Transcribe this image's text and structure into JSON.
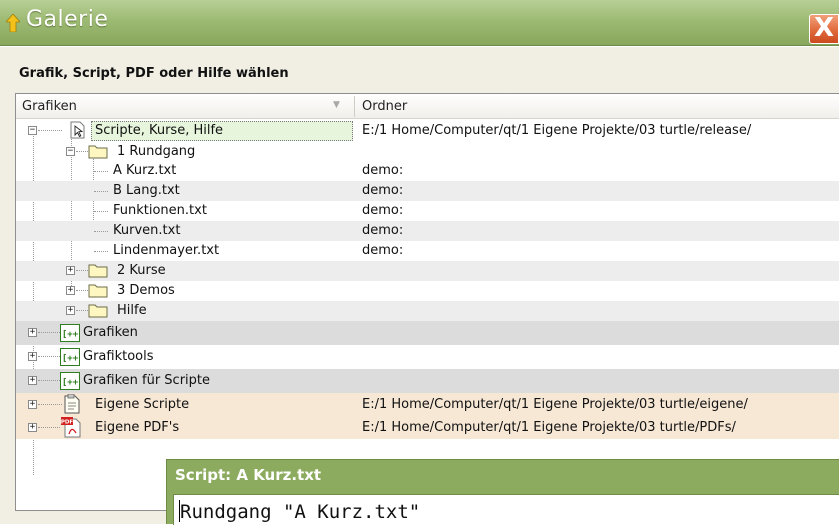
{
  "window": {
    "title": "Galerie",
    "close_label": "X"
  },
  "dialog": {
    "prompt": "Grafik, Script, PDF oder Hilfe wählen"
  },
  "tree": {
    "columns": [
      "Grafiken",
      "Ordner"
    ],
    "rows": [
      {
        "label": "Scripte, Kurse, Hilfe",
        "folder": "E:/1 Home/Computer/qt/1 Eigene Projekte/03 turtle/release/",
        "icon": "script-arrow-icon",
        "expander": "minus",
        "selected": true
      },
      {
        "label": "1 Rundgang",
        "folder": "",
        "icon": "folder-icon",
        "expander": "minus"
      },
      {
        "label": "A Kurz.txt",
        "folder": "demo:",
        "icon": ""
      },
      {
        "label": "B Lang.txt",
        "folder": "demo:",
        "icon": ""
      },
      {
        "label": "Funktionen.txt",
        "folder": "demo:",
        "icon": ""
      },
      {
        "label": "Kurven.txt",
        "folder": "demo:",
        "icon": ""
      },
      {
        "label": "Lindenmayer.txt",
        "folder": "demo:",
        "icon": ""
      },
      {
        "label": "2 Kurse",
        "folder": "",
        "icon": "folder-icon",
        "expander": "plus"
      },
      {
        "label": "3 Demos",
        "folder": "",
        "icon": "folder-icon",
        "expander": "plus"
      },
      {
        "label": "Hilfe",
        "folder": "",
        "icon": "folder-icon",
        "expander": "plus"
      },
      {
        "label": "Grafiken",
        "folder": "",
        "icon": "cpp-icon",
        "expander": "plus"
      },
      {
        "label": "Grafiktools",
        "folder": "",
        "icon": "cpp-icon",
        "expander": "plus"
      },
      {
        "label": "Grafiken für Scripte",
        "folder": "",
        "icon": "cpp-icon",
        "expander": "plus"
      },
      {
        "label": "Eigene Scripte",
        "folder": "E:/1 Home/Computer/qt/1 Eigene Projekte/03 turtle/eigene/",
        "icon": "script-page-icon",
        "expander": "plus"
      },
      {
        "label": "Eigene PDF's",
        "folder": "E:/1 Home/Computer/qt/1 Eigene Projekte/03 turtle/PDFs/",
        "icon": "pdf-icon",
        "expander": "plus"
      }
    ]
  },
  "script_window": {
    "title": "Script: A Kurz.txt",
    "content": "Rundgang \"A Kurz.txt\""
  },
  "colors": {
    "titlebar": "#9dba73",
    "close_button": "#e06a3c",
    "selection": "#e6f5dc",
    "alt_row": "#ededed",
    "grafik_row": "#dcdcdc",
    "own_row": "#f7e8d6",
    "script_title": "#8cab5f"
  }
}
